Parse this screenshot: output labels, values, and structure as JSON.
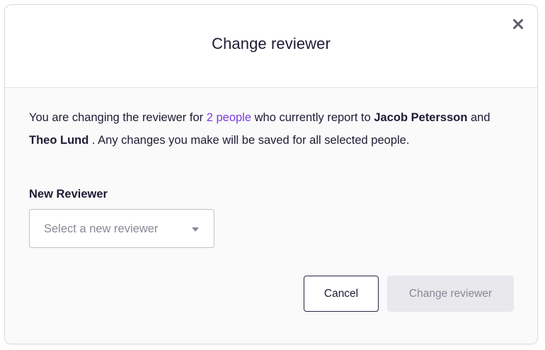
{
  "dialog": {
    "title": "Change reviewer",
    "close_icon": "close-icon"
  },
  "body": {
    "description": {
      "prefix": "You are changing the reviewer for ",
      "people_link": "2 people",
      "mid": " who currently report to ",
      "manager_1": "Jacob Petersson",
      "and": " and ",
      "manager_2": "Theo Lund",
      "suffix": " . Any changes you make will be saved for all selected people."
    },
    "new_reviewer_label": "New Reviewer",
    "select": {
      "placeholder": "Select a new reviewer",
      "caret_icon": "caret-down-icon"
    }
  },
  "footer": {
    "cancel_label": "Cancel",
    "submit_label": "Change reviewer"
  },
  "colors": {
    "accent": "#7a3de0",
    "text": "#1f1a33",
    "muted": "#8a8797",
    "disabled_bg": "#e9e8ed"
  }
}
